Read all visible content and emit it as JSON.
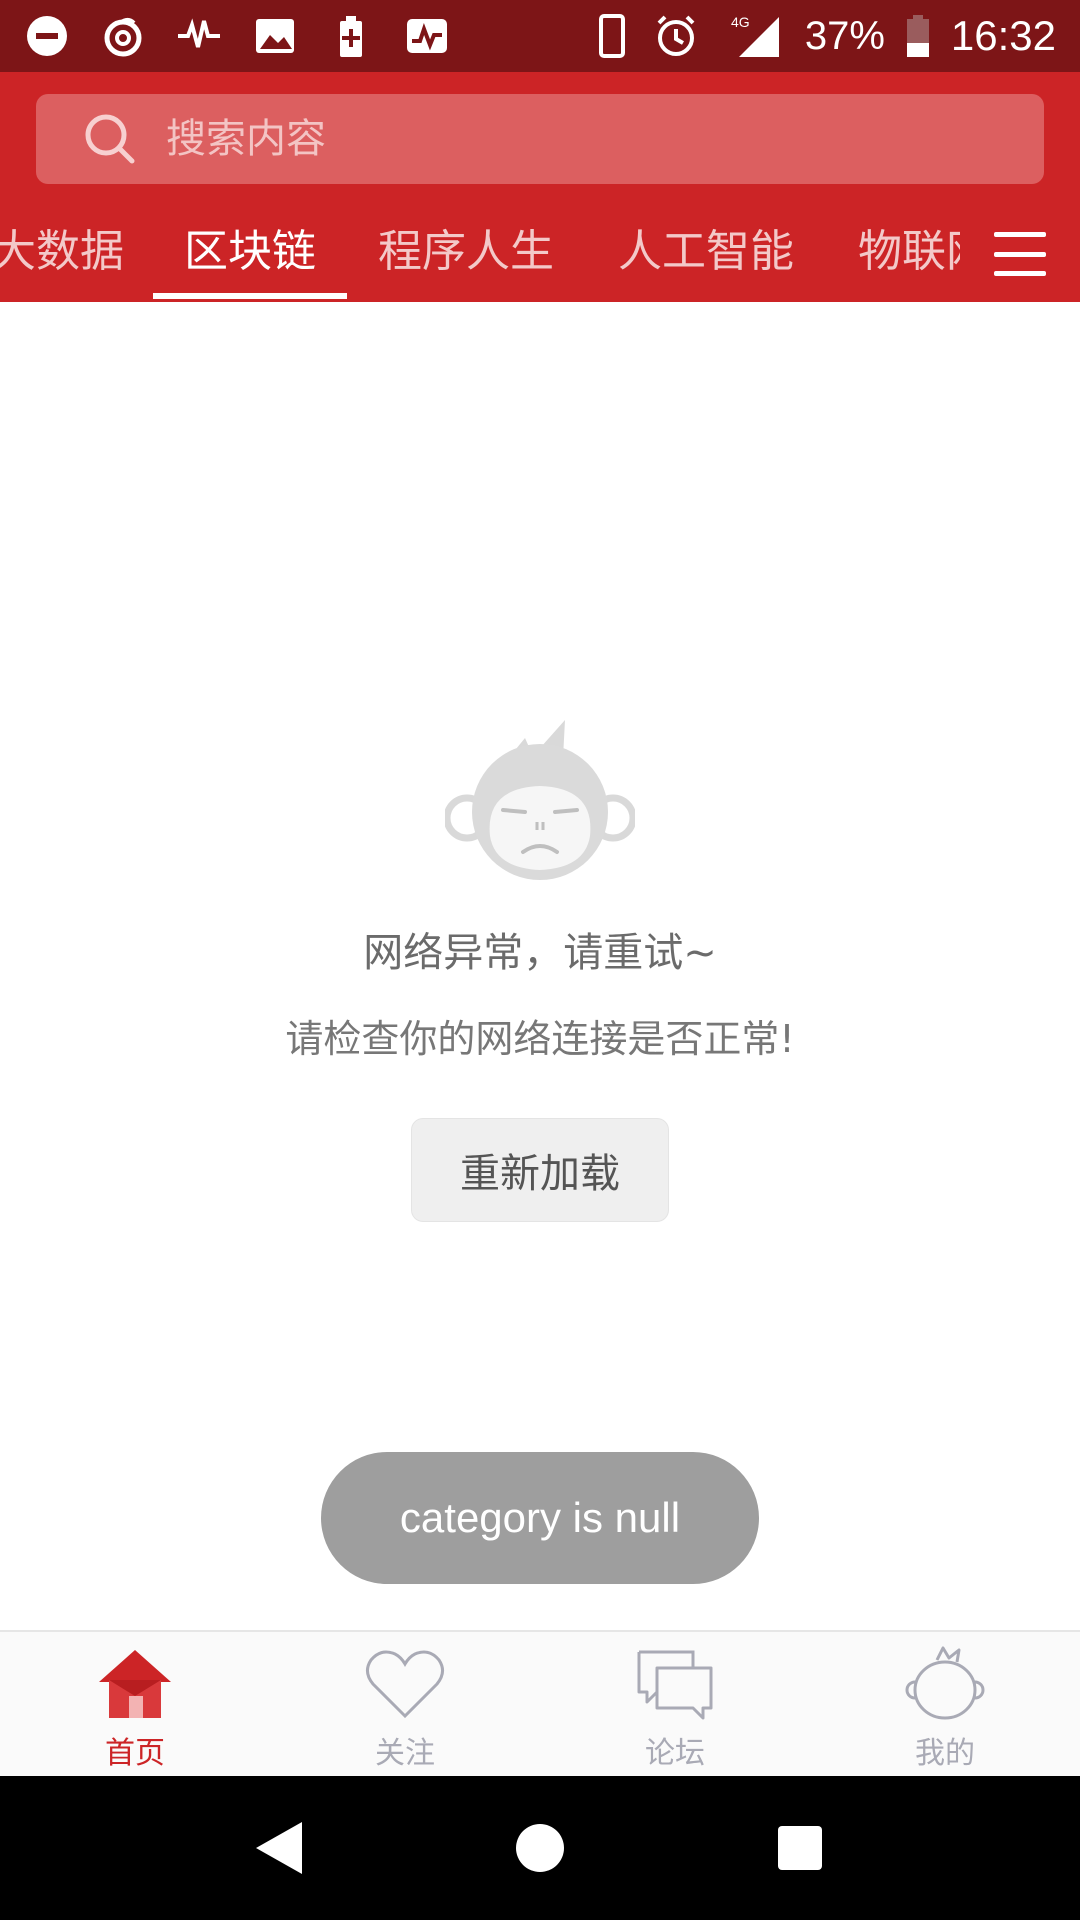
{
  "status_bar": {
    "battery": "37%",
    "time": "16:32",
    "network": "4G"
  },
  "search": {
    "placeholder": "搜索内容"
  },
  "tabs": [
    {
      "label": "大数据"
    },
    {
      "label": "区块链"
    },
    {
      "label": "程序人生"
    },
    {
      "label": "人工智能"
    },
    {
      "label": "物联网"
    }
  ],
  "active_tab": "区块链",
  "empty_state": {
    "title": "网络异常，请重试~",
    "subtitle": "请检查你的网络连接是否正常!",
    "reload_label": "重新加载"
  },
  "toast": {
    "text": "category is null"
  },
  "bottom_nav": [
    {
      "label": "首页",
      "icon": "home-icon"
    },
    {
      "label": "关注",
      "icon": "heart-icon"
    },
    {
      "label": "论坛",
      "icon": "chat-icon"
    },
    {
      "label": "我的",
      "icon": "monkey-face-icon"
    }
  ],
  "colors": {
    "status_bar": "#7d1517",
    "header": "#cc2426",
    "search_box": "#dc5f60",
    "active_nav": "#cc2426",
    "inactive_nav": "#a9aab5",
    "toast": "#9e9e9e"
  }
}
